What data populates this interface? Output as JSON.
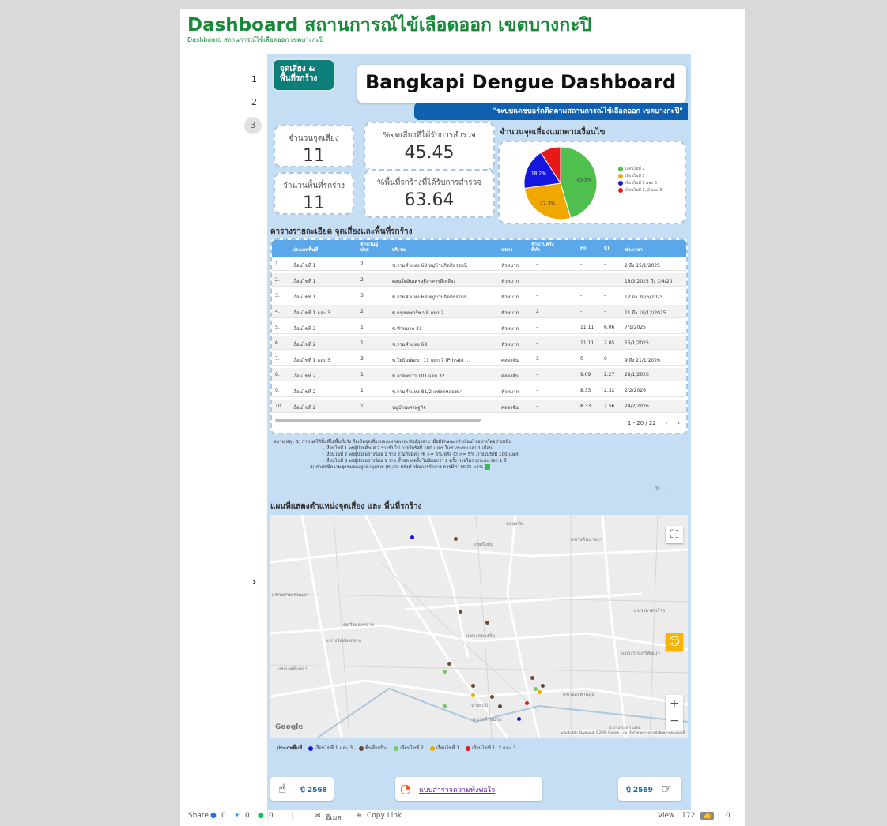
{
  "page": {
    "title": "Dashboard สถานการณ์ไข้เลือดออก เขตบางกะปิ",
    "subtitle": "Dashboard สถานการณ์ไข้เลือดออก เขตบางกะปิ"
  },
  "pager": {
    "pages": [
      "1",
      "2",
      "3"
    ],
    "active_index": 2,
    "next_label": "›"
  },
  "header": {
    "badge": "จุดเสี่ยง & พื้นที่รกร้าง",
    "title": "Bangkapi Dengue Dashboard",
    "tagline": "\"ระบบแดชบอร์ดติดตามสถานการณ์ไข้เลือดออก เขตบางกะปิ\""
  },
  "kpis": [
    {
      "label": "จำนวนจุดเสี่ยง",
      "value": "11"
    },
    {
      "label": "%จุดเสี่ยงที่ได้รับการสำรวจ",
      "value": "45.45"
    },
    {
      "label": "จำนวนพื้นที่รกร้าง",
      "value": "11"
    },
    {
      "label": "%พื้นที่รกร้างที่ได้รับการสำรวจ",
      "value": "63.64"
    }
  ],
  "chart_data": {
    "type": "pie",
    "title": "จำนวนจุดเสี่ยงแยกตามเงื่อนไข",
    "slices": [
      {
        "label": "เงื่อนไขที่ 2",
        "value": 45.5,
        "color": "#4fc04d",
        "shown_label": "45.5%"
      },
      {
        "label": "เงื่อนไขที่ 1",
        "value": 27.3,
        "color": "#f0a800",
        "shown_label": "27.3%"
      },
      {
        "label": "เงื่อนไขที่ 1 และ 3",
        "value": 18.2,
        "color": "#1515e0",
        "shown_label": "18.2%"
      },
      {
        "label": "เงื่อนไขที่ 1, 2 และ 3",
        "value": 9.1,
        "color": "#e81818",
        "shown_label": ""
      }
    ],
    "legend_position": "right"
  },
  "table": {
    "heading": "ตารางรายละเอียด จุดเสี่ยงและพื้นที่รกร้าง",
    "columns": [
      "ประเภทพื้นที่",
      "จำนวนผู้ป่วย",
      "บริเวณ",
      "แขวง",
      "จำนวนครั้งที่ทำ",
      "HI",
      "CI",
      "ช่วงเวลา"
    ],
    "rows": [
      {
        "no": "1.",
        "type": "เงื่อนไขที่ 1",
        "patients": "2",
        "area": "ซ.รามคำแหง 68 หมู่บ้านกิตติธรรมนี",
        "khwaeng": "หัวหมาก",
        "times": "-",
        "hi": "-",
        "ci": "-",
        "period": "2 ถึง 15/1/2025"
      },
      {
        "no": "2.",
        "type": "เงื่อนไขที่ 1",
        "patients": "2",
        "area": "คอนโดสินเศรษฐีอาคารสีเหลือง",
        "khwaeng": "หัวหมาก",
        "times": "-",
        "hi": "-",
        "ci": "-",
        "period": "18/3/2025 ถึง 1/4/20"
      },
      {
        "no": "3.",
        "type": "เงื่อนไขที่ 1",
        "patients": "3",
        "area": "ซ.รามคำแหง 68 หมู่บ้านกิตติธรรมนี",
        "khwaeng": "หัวหมาก",
        "times": "-",
        "hi": "-",
        "ci": "-",
        "period": "12 ถึง 30/6/2025"
      },
      {
        "no": "4.",
        "type": "เงื่อนไขที่ 1 และ 3",
        "patients": "2",
        "area": "ซ.กรุงเทพกรีฑา 8 แยก 2",
        "khwaeng": "หัวหมาก",
        "times": "2",
        "hi": "-",
        "ci": "-",
        "period": "11 ถึง 18/12/2025"
      },
      {
        "no": "5.",
        "type": "เงื่อนไขที่ 2",
        "patients": "1",
        "area": "ซ.หัวหมาก 21",
        "khwaeng": "หัวหมาก",
        "times": "-",
        "hi": "11.11",
        "ci": "6.06",
        "period": "7/1/2025"
      },
      {
        "no": "6.",
        "type": "เงื่อนไขที่ 2",
        "patients": "1",
        "area": "ซ.รามคำแหง 68",
        "khwaeng": "หัวหมาก",
        "times": "-",
        "hi": "11.11",
        "ci": "2.85",
        "period": "15/1/2025"
      },
      {
        "no": "7.",
        "type": "เงื่อนไขที่ 1 และ 3",
        "patients": "3",
        "area": "ซ.โยธินพัฒนา 11 แยก 7 (Private ...",
        "khwaeng": "คลองจั่น",
        "times": "3",
        "hi": "0",
        "ci": "0",
        "period": "9 ถึง 21/1/2026"
      },
      {
        "no": "8.",
        "type": "เงื่อนไขที่ 2",
        "patients": "1",
        "area": "ซ.ลาดพร้าว 101 แยก 32",
        "khwaeng": "คลองจั่น",
        "times": "-",
        "hi": "9.09",
        "ci": "2.27",
        "period": "29/1/2026"
      },
      {
        "no": "9.",
        "type": "เงื่อนไขที่ 2",
        "patients": "1",
        "area": "ซ.รามคำแหง 81/2 แฟลตหลองหา",
        "khwaeng": "หัวหมาก",
        "times": "-",
        "hi": "8.33",
        "ci": "2.32",
        "period": "2/2/2026"
      },
      {
        "no": "10.",
        "type": "เงื่อนไขที่ 2",
        "patients": "1",
        "area": "หมู่บ้านเศรษฐกิจ",
        "khwaeng": "คลองจั่น",
        "times": "-",
        "hi": "8.33",
        "ci": "2.56",
        "period": "24/2/2026"
      }
    ],
    "pagination": "1 - 20 / 22",
    "prev": "‹",
    "next": "›"
  },
  "notes": [
    "หมายเหตุ : 1) กำหนดให้พื้นที่ไม่พื้นที่กรัง ถือเป็นจุดเสี่ยงของแหล่งพาหะพันธุ์ยุงลาย เมื่อมีลักษณะเข้าเงื่อนไขอย่างใดอย่างหนึ่ง",
    "- เงื่อนไขที่ 1 พบผู้ป่วยตั้งแต่ 2 รายขึ้นไป ภายในรัศมี 100 เมตร ในช่วงระยะเวลา 1 เดือน",
    "- เงื่อนไขที่ 2 พบผู้ป่วยอย่างน้อย 1 ราย ร่วมกับมีค่า HI >= 5% หรือ CI >= 5% ภายในรัศมี 100 เมตร",
    "- เงื่อนไขที่ 3 พบผู้ป่วยอย่างน้อย 1 ราย ซ้ำหลายครั้ง ไม่น้อยกว่า 2 ครั้ง ภายในช่วงระยะเวลา 1 ปี",
    "2) ค่าดัชนีความชุกชุมของลูกน้ำยุงลาย (HI,CI) หลังดำเนินการจัดการ ควรมีค่า HI,CI <5%"
  ],
  "map": {
    "heading": "แผนที่แสดงตำแหน่งจุดเสี่ยง และ พื้นที่รกร้าง",
    "labels": [
      "คลองจั่น",
      "เขตบึงกุ่ม",
      "แขวงคันนายาว",
      "แขวงสามเสนนอก",
      "เขตวังทองหลาง",
      "แขวงวังทองหลาง",
      "แขวงพลับพลา",
      "แขวงคลองจั่น",
      "บางกะปิ",
      "แขวงหัวหมาก",
      "แขวงสะพานสูง",
      "แขวงราษฎร์พัฒนา",
      "แขวงสะพานสูง",
      "แขวงลาดพร้าว"
    ],
    "attribution": "แป้นพิมพ์ลัด  ข้อมูลแผนที่ ©2026 Google   1 กม.   ข้อกำหนด   รายงานข้อผิดพลาดของแผนที่",
    "google_label": "Google",
    "fullscreen_icon": "fullscreen-icon",
    "zoom_in": "+",
    "zoom_out": "−",
    "legend_title": "ประเภทพื้นที่",
    "legend": [
      {
        "label": "เงื่อนไขที่ 1 และ 3",
        "color": "#1515e0"
      },
      {
        "label": "พื้นที่รกร้าง",
        "color": "#6b4a34"
      },
      {
        "label": "เงื่อนไขที่ 2",
        "color": "#6ccd5d"
      },
      {
        "label": "เงื่อนไขที่ 1",
        "color": "#f0a800"
      },
      {
        "label": "เงื่อนไขที่ 1, 2 และ 3",
        "color": "#e81818"
      }
    ]
  },
  "nav": {
    "prev_year": "ปี 2568",
    "survey_link": "แบบสำรวจความพึงพอใจ",
    "next_year": "ปี 2569"
  },
  "footer": {
    "share_label": "Share",
    "fb_count": "0",
    "tw_count": "0",
    "line_count": "0",
    "email_label": "อีเมล",
    "copy_label": "Copy Link",
    "views_label": "View : 172",
    "likes": "0"
  }
}
